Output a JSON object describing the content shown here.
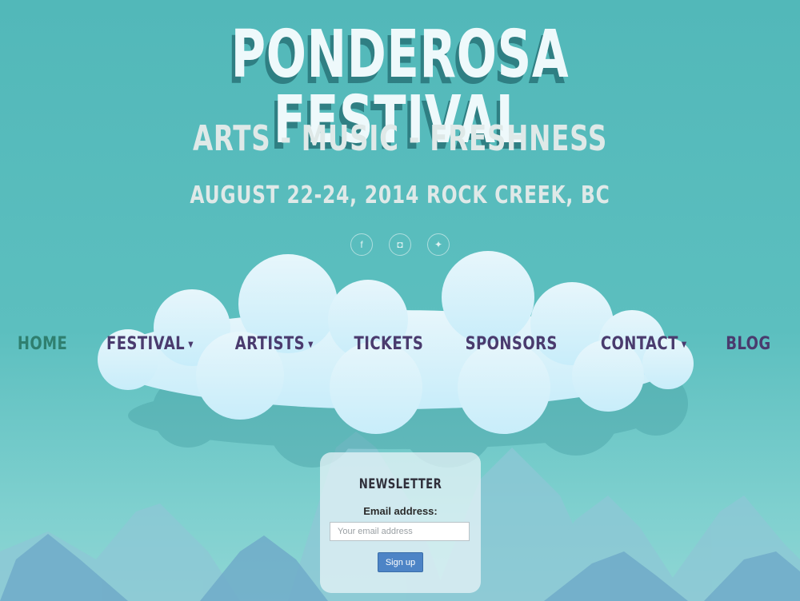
{
  "header": {
    "title": "PONDEROSA FESTIVAL",
    "subtitle": "ARTS - MUSIC - FRESHNESS",
    "dateline": "AUGUST 22-24, 2014 ROCK CREEK, BC"
  },
  "social": [
    {
      "icon": "facebook-icon",
      "glyph": "f"
    },
    {
      "icon": "instagram-icon",
      "glyph": "◘"
    },
    {
      "icon": "twitter-icon",
      "glyph": "✦"
    }
  ],
  "nav": {
    "items": [
      {
        "label": "HOME",
        "active": true,
        "dropdown": false
      },
      {
        "label": "FESTIVAL",
        "active": false,
        "dropdown": true
      },
      {
        "label": "ARTISTS",
        "active": false,
        "dropdown": true
      },
      {
        "label": "TICKETS",
        "active": false,
        "dropdown": false
      },
      {
        "label": "SPONSORS",
        "active": false,
        "dropdown": false
      },
      {
        "label": "CONTACT",
        "active": false,
        "dropdown": true
      },
      {
        "label": "BLOG",
        "active": false,
        "dropdown": false
      }
    ]
  },
  "newsletter": {
    "title": "NEWSLETTER",
    "email_label": "Email address:",
    "email_value": "",
    "email_placeholder": "Your email address",
    "signup_label": "Sign up"
  },
  "colors": {
    "sky": "#52b8b9",
    "title": "#eef9fb",
    "title_shadow": "#2f7f83",
    "nav_text": "#4a3b6e",
    "nav_active": "#2f7f6f",
    "button": "#4d84c6"
  }
}
